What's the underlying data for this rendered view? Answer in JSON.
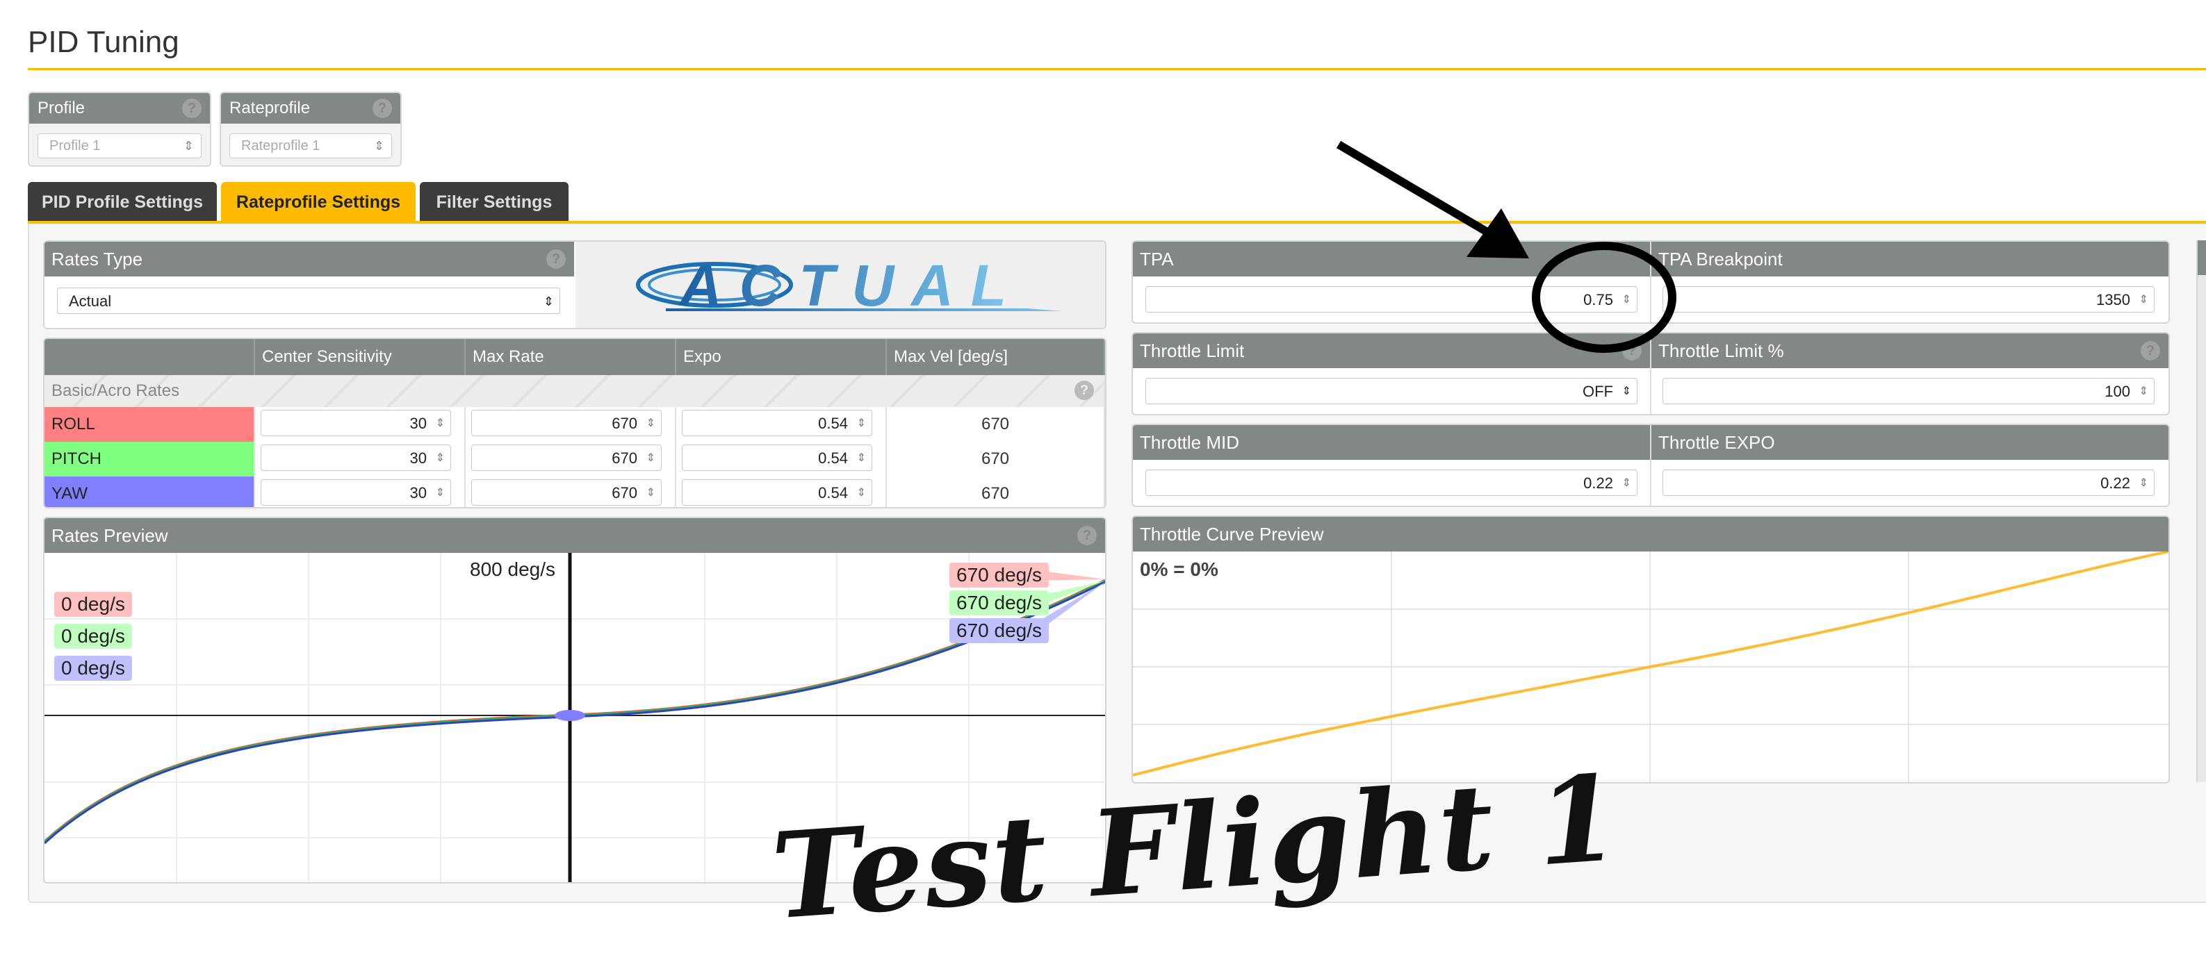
{
  "page_title": "PID Tuning",
  "selectors": {
    "profile": {
      "label": "Profile",
      "value": "Profile 1"
    },
    "rateprofile": {
      "label": "Rateprofile",
      "value": "Rateprofile 1"
    },
    "help_glyph": "?"
  },
  "tabs": [
    {
      "label": "PID Profile Settings",
      "active": false
    },
    {
      "label": "Rateprofile Settings",
      "active": true
    },
    {
      "label": "Filter Settings",
      "active": false
    }
  ],
  "rates_type": {
    "label": "Rates Type",
    "value": "Actual",
    "logo_text": "ACTUAL"
  },
  "rates_table": {
    "columns": [
      "",
      "Center Sensitivity",
      "Max Rate",
      "Expo",
      "Max Vel [deg/s]"
    ],
    "section": "Basic/Acro Rates",
    "rows": [
      {
        "axis": "ROLL",
        "center": "30",
        "max_rate": "670",
        "expo": "0.54",
        "max_vel": "670",
        "color": "#ff8080"
      },
      {
        "axis": "PITCH",
        "center": "30",
        "max_rate": "670",
        "expo": "0.54",
        "max_vel": "670",
        "color": "#80ff80"
      },
      {
        "axis": "YAW",
        "center": "30",
        "max_rate": "670",
        "expo": "0.54",
        "max_vel": "670",
        "color": "#8080ff"
      }
    ]
  },
  "rates_preview": {
    "label": "Rates Preview",
    "max_label": "800 deg/s",
    "current": [
      "0 deg/s",
      "0 deg/s",
      "0 deg/s"
    ],
    "max": [
      "670 deg/s",
      "670 deg/s",
      "670 deg/s"
    ]
  },
  "tpa": {
    "label": "TPA",
    "value": "0.75"
  },
  "tpa_breakpoint": {
    "label": "TPA Breakpoint",
    "value": "1350"
  },
  "throttle_limit": {
    "label": "Throttle Limit",
    "value": "OFF"
  },
  "throttle_limit_pct": {
    "label": "Throttle Limit %",
    "value": "100"
  },
  "throttle_mid": {
    "label": "Throttle MID",
    "value": "0.22"
  },
  "throttle_expo": {
    "label": "Throttle EXPO",
    "value": "0.22"
  },
  "throttle_curve": {
    "label": "Throttle Curve Preview",
    "readout": "0% = 0%",
    "line_color": "#ffbb33"
  },
  "annotation": {
    "handwritten": "Test Flight 1"
  },
  "colors": {
    "accent": "#ffbb00",
    "header": "#828885",
    "roll": "#ff8080",
    "pitch": "#80ff80",
    "yaw": "#8080ff"
  }
}
